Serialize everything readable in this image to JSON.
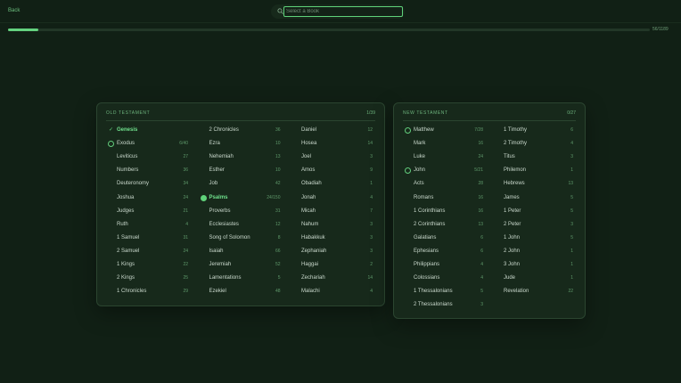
{
  "header": {
    "back_label": "Back",
    "search_placeholder": "Select a Book",
    "search_value": ""
  },
  "progress": {
    "label": "56/1189",
    "fraction": 0.047
  },
  "colors": {
    "background": "#112015",
    "panel": "#17291b",
    "accent": "#5fd27a",
    "muted_accent": "#6cb27c"
  },
  "old_testament": {
    "title": "OLD TESTAMENT",
    "count": "1/39",
    "columns": [
      [
        {
          "name": "Genesis",
          "count": "",
          "status": "done"
        },
        {
          "name": "Exodus",
          "count": "6/40",
          "status": "partial"
        },
        {
          "name": "Leviticus",
          "count": "27",
          "status": "none"
        },
        {
          "name": "Numbers",
          "count": "36",
          "status": "none"
        },
        {
          "name": "Deuteronomy",
          "count": "34",
          "status": "none"
        },
        {
          "name": "Joshua",
          "count": "24",
          "status": "none"
        },
        {
          "name": "Judges",
          "count": "21",
          "status": "none"
        },
        {
          "name": "Ruth",
          "count": "4",
          "status": "none"
        },
        {
          "name": "1 Samuel",
          "count": "31",
          "status": "none"
        },
        {
          "name": "2 Samuel",
          "count": "24",
          "status": "none"
        },
        {
          "name": "1 Kings",
          "count": "22",
          "status": "none"
        },
        {
          "name": "2 Kings",
          "count": "25",
          "status": "none"
        },
        {
          "name": "1 Chronicles",
          "count": "29",
          "status": "none"
        }
      ],
      [
        {
          "name": "2 Chronicles",
          "count": "36",
          "status": "none"
        },
        {
          "name": "Ezra",
          "count": "10",
          "status": "none"
        },
        {
          "name": "Nehemiah",
          "count": "13",
          "status": "none"
        },
        {
          "name": "Esther",
          "count": "10",
          "status": "none"
        },
        {
          "name": "Job",
          "count": "42",
          "status": "none"
        },
        {
          "name": "Psalms",
          "count": "24/150",
          "status": "current"
        },
        {
          "name": "Proverbs",
          "count": "31",
          "status": "none"
        },
        {
          "name": "Ecclesiastes",
          "count": "12",
          "status": "none"
        },
        {
          "name": "Song of Solomon",
          "count": "8",
          "status": "none"
        },
        {
          "name": "Isaiah",
          "count": "66",
          "status": "none"
        },
        {
          "name": "Jeremiah",
          "count": "52",
          "status": "none"
        },
        {
          "name": "Lamentations",
          "count": "5",
          "status": "none"
        },
        {
          "name": "Ezekiel",
          "count": "48",
          "status": "none"
        }
      ],
      [
        {
          "name": "Daniel",
          "count": "12",
          "status": "none"
        },
        {
          "name": "Hosea",
          "count": "14",
          "status": "none"
        },
        {
          "name": "Joel",
          "count": "3",
          "status": "none"
        },
        {
          "name": "Amos",
          "count": "9",
          "status": "none"
        },
        {
          "name": "Obadiah",
          "count": "1",
          "status": "none"
        },
        {
          "name": "Jonah",
          "count": "4",
          "status": "none"
        },
        {
          "name": "Micah",
          "count": "7",
          "status": "none"
        },
        {
          "name": "Nahum",
          "count": "3",
          "status": "none"
        },
        {
          "name": "Habakkuk",
          "count": "3",
          "status": "none"
        },
        {
          "name": "Zephaniah",
          "count": "3",
          "status": "none"
        },
        {
          "name": "Haggai",
          "count": "2",
          "status": "none"
        },
        {
          "name": "Zechariah",
          "count": "14",
          "status": "none"
        },
        {
          "name": "Malachi",
          "count": "4",
          "status": "none"
        }
      ]
    ]
  },
  "new_testament": {
    "title": "NEW TESTAMENT",
    "count": "0/27",
    "columns": [
      [
        {
          "name": "Matthew",
          "count": "7/28",
          "status": "partial"
        },
        {
          "name": "Mark",
          "count": "16",
          "status": "none"
        },
        {
          "name": "Luke",
          "count": "24",
          "status": "none"
        },
        {
          "name": "John",
          "count": "5/21",
          "status": "partial"
        },
        {
          "name": "Acts",
          "count": "28",
          "status": "none"
        },
        {
          "name": "Romans",
          "count": "16",
          "status": "none"
        },
        {
          "name": "1 Corinthians",
          "count": "16",
          "status": "none"
        },
        {
          "name": "2 Corinthians",
          "count": "13",
          "status": "none"
        },
        {
          "name": "Galatians",
          "count": "6",
          "status": "none"
        },
        {
          "name": "Ephesians",
          "count": "6",
          "status": "none"
        },
        {
          "name": "Philippians",
          "count": "4",
          "status": "none"
        },
        {
          "name": "Colossians",
          "count": "4",
          "status": "none"
        },
        {
          "name": "1 Thessalonians",
          "count": "5",
          "status": "none"
        },
        {
          "name": "2 Thessalonians",
          "count": "3",
          "status": "none"
        }
      ],
      [
        {
          "name": "1 Timothy",
          "count": "6",
          "status": "none"
        },
        {
          "name": "2 Timothy",
          "count": "4",
          "status": "none"
        },
        {
          "name": "Titus",
          "count": "3",
          "status": "none"
        },
        {
          "name": "Philemon",
          "count": "1",
          "status": "none"
        },
        {
          "name": "Hebrews",
          "count": "13",
          "status": "none"
        },
        {
          "name": "James",
          "count": "5",
          "status": "none"
        },
        {
          "name": "1 Peter",
          "count": "5",
          "status": "none"
        },
        {
          "name": "2 Peter",
          "count": "3",
          "status": "none"
        },
        {
          "name": "1 John",
          "count": "5",
          "status": "none"
        },
        {
          "name": "2 John",
          "count": "1",
          "status": "none"
        },
        {
          "name": "3 John",
          "count": "1",
          "status": "none"
        },
        {
          "name": "Jude",
          "count": "1",
          "status": "none"
        },
        {
          "name": "Revelation",
          "count": "22",
          "status": "none"
        }
      ]
    ]
  }
}
